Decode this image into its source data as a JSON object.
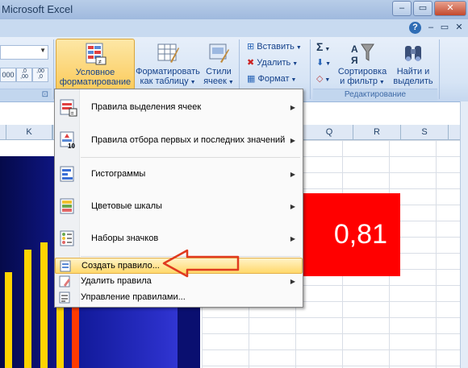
{
  "window": {
    "title": "Microsoft Excel"
  },
  "ribbon": {
    "conditional_formatting": {
      "line1": "Условное",
      "line2": "форматирование"
    },
    "format_as_table": {
      "line1": "Форматировать",
      "line2": "как таблицу"
    },
    "cell_styles": {
      "line1": "Стили",
      "line2": "ячеек"
    },
    "insert_label": "Вставить",
    "delete_label": "Удалить",
    "format_label": "Формат",
    "sum_symbol": "Σ",
    "sort_filter": {
      "line1": "Сортировка",
      "line2": "и фильтр"
    },
    "find_select": {
      "line1": "Найти и",
      "line2": "выделить"
    },
    "editing_group_label": "Редактирование",
    "number_buttons": [
      "000",
      ",0\n,00",
      ",00\n,0"
    ]
  },
  "columns": [
    {
      "label": "K"
    },
    {
      "label": "Q"
    },
    {
      "label": "R"
    },
    {
      "label": "S"
    }
  ],
  "cell": {
    "value": "0,81",
    "background": "#ff0000"
  },
  "menu": {
    "items": [
      {
        "label": "Правила выделения ячеек",
        "underline": "П",
        "has_submenu": true,
        "icon": "highlight-rules-icon"
      },
      {
        "label": "Правила отбора первых и последних значений",
        "has_submenu": true,
        "icon": "top-bottom-rules-icon"
      },
      {
        "label": "Гистограммы",
        "has_submenu": true,
        "icon": "data-bars-icon"
      },
      {
        "label": "Цветовые шкалы",
        "has_submenu": true,
        "icon": "color-scales-icon"
      },
      {
        "label": "Наборы значков",
        "has_submenu": true,
        "icon": "icon-sets-icon"
      }
    ],
    "small_items": [
      {
        "label": "Создать правило...",
        "has_submenu": false,
        "icon": "new-rule-icon"
      },
      {
        "label": "Удалить правила",
        "has_submenu": true,
        "icon": "clear-rules-icon"
      },
      {
        "label": "Управление правилами...",
        "has_submenu": false,
        "icon": "manage-rules-icon"
      }
    ]
  },
  "chart_bars": [
    {
      "color": "#ffd400",
      "level": 0.42
    },
    {
      "color": "#ffd400",
      "level": 0.52
    },
    {
      "color": "#ffd400",
      "level": 0.55
    },
    {
      "color": "#ffd400",
      "level": 0.58
    },
    {
      "color": "#ff3a00",
      "level": 0.58
    }
  ],
  "colors": {
    "accent": "#fbcb5c",
    "highlight_red": "#ff0000",
    "annotation_arrow": "#e03a1e"
  }
}
